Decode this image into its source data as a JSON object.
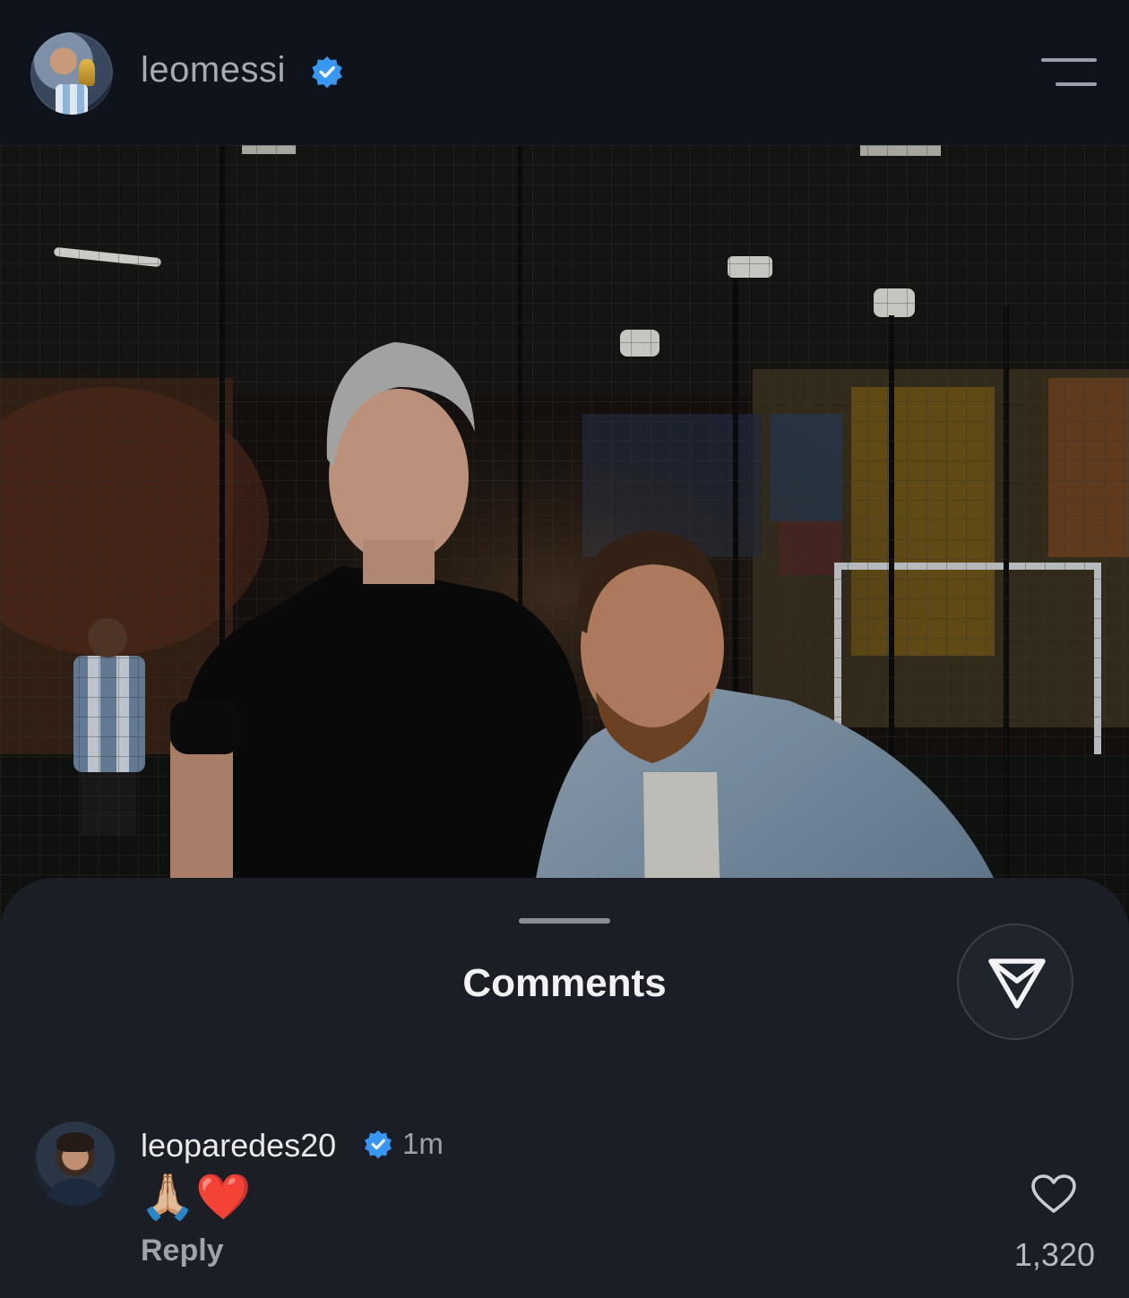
{
  "header": {
    "username": "leomessi",
    "verified": true,
    "menu_icon": "hamburger-menu-icon"
  },
  "post": {
    "image": "photo-two-men-indoor-soccer-facility"
  },
  "comments_sheet": {
    "title": "Comments",
    "share_icon": "send-icon",
    "comments": [
      {
        "username": "leoparedes20",
        "verified": true,
        "time": "1m",
        "text": "🙏🏼❤️",
        "reply_label": "Reply",
        "likes": "1,320"
      }
    ]
  },
  "colors": {
    "background": "#0f131b",
    "sheet": "#1b1e25",
    "verified_blue": "#3897f0",
    "text_primary": "#f2f3f5",
    "text_secondary": "#9ea2aa"
  }
}
